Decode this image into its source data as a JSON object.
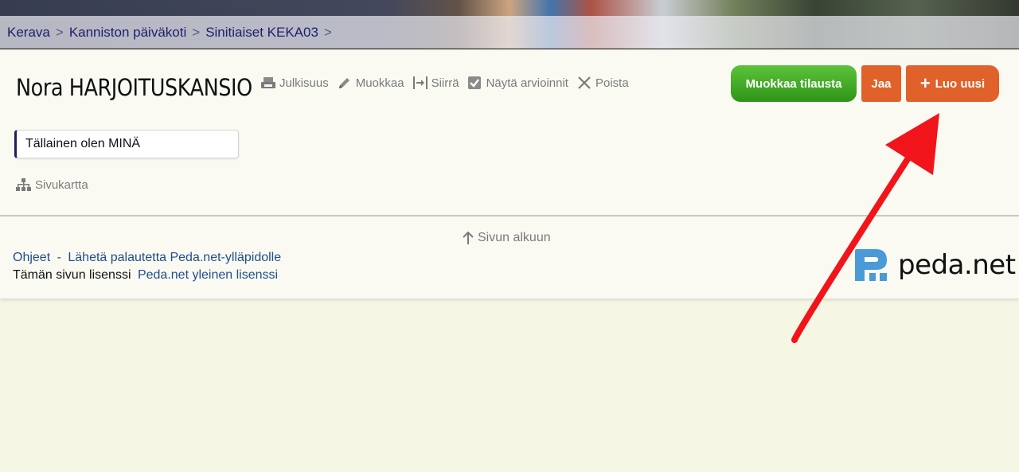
{
  "breadcrumb": {
    "items": [
      "Kerava",
      "Kanniston päiväkoti",
      "Sinitiaiset KEKA03"
    ],
    "separator": ">"
  },
  "page": {
    "title": "Nora HARJOITUSKANSIO"
  },
  "toolbar": {
    "julkisuus": "Julkisuus",
    "muokkaa": "Muokkaa",
    "siirra": "Siirrä",
    "nayta_arvioinnit": "Näytä arvioinnit",
    "poista": "Poista"
  },
  "actions": {
    "edit_subscription": "Muokkaa tilausta",
    "share": "Jaa",
    "create_new": "Luo uusi",
    "create_new_icon": "+"
  },
  "tab": {
    "label": "Tällainen olen MINÄ"
  },
  "sitemap": {
    "label": "Sivukartta"
  },
  "footer": {
    "to_top": "Sivun alkuun",
    "help": "Ohjeet",
    "dash": "-",
    "feedback": "Lähetä palautetta Peda.net-ylläpidolle",
    "license_prefix": "Tämän sivun lisenssi",
    "license_link": "Peda.net yleinen lisenssi",
    "logo_text": "peda.net"
  },
  "colors": {
    "breadcrumb_text": "#1b1f6e",
    "green_button": "#3aa51f",
    "orange_button": "#e0612a",
    "link": "#1f4e8c",
    "annotation_arrow": "#f2141b",
    "logo_blue": "#4a9ad8"
  },
  "icons": {
    "julkisuus": "printer-icon",
    "muokkaa": "pencil-icon",
    "siirra": "move-icon",
    "nayta_arvioinnit": "checkbox-icon",
    "poista": "close-icon",
    "sitemap": "sitemap-icon",
    "to_top": "arrow-up-icon"
  }
}
